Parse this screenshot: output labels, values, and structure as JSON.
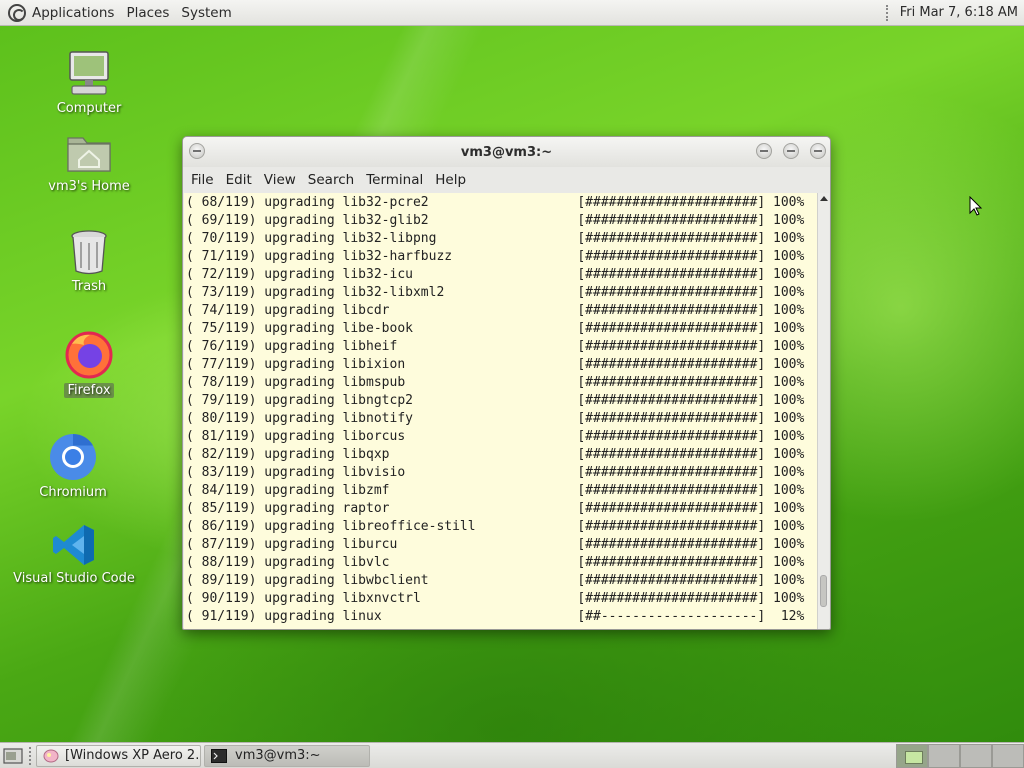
{
  "top_panel": {
    "menus": [
      "Applications",
      "Places",
      "System"
    ],
    "clock": "Fri Mar 7, 6:18 AM"
  },
  "desktop": {
    "icons": [
      {
        "label": "Computer",
        "icon": "computer-icon"
      },
      {
        "label": "vm3's Home",
        "icon": "home-folder-icon"
      },
      {
        "label": "Trash",
        "icon": "trash-icon"
      },
      {
        "label": "Firefox",
        "icon": "firefox-icon"
      },
      {
        "label": "Chromium",
        "icon": "chromium-icon"
      },
      {
        "label": "Visual Studio Code",
        "icon": "vscode-icon"
      }
    ]
  },
  "terminal": {
    "title": "vm3@vm3:~",
    "menu": [
      "File",
      "Edit",
      "View",
      "Search",
      "Terminal",
      "Help"
    ],
    "lines": [
      "( 68/119) upgrading lib32-pcre2                   [######################] 100%",
      "( 69/119) upgrading lib32-glib2                   [######################] 100%",
      "( 70/119) upgrading lib32-libpng                  [######################] 100%",
      "( 71/119) upgrading lib32-harfbuzz                [######################] 100%",
      "( 72/119) upgrading lib32-icu                     [######################] 100%",
      "( 73/119) upgrading lib32-libxml2                 [######################] 100%",
      "( 74/119) upgrading libcdr                        [######################] 100%",
      "( 75/119) upgrading libe-book                     [######################] 100%",
      "( 76/119) upgrading libheif                       [######################] 100%",
      "( 77/119) upgrading libixion                      [######################] 100%",
      "( 78/119) upgrading libmspub                      [######################] 100%",
      "( 79/119) upgrading libngtcp2                     [######################] 100%",
      "( 80/119) upgrading libnotify                     [######################] 100%",
      "( 81/119) upgrading liborcus                      [######################] 100%",
      "( 82/119) upgrading libqxp                        [######################] 100%",
      "( 83/119) upgrading libvisio                      [######################] 100%",
      "( 84/119) upgrading libzmf                        [######################] 100%",
      "( 85/119) upgrading raptor                        [######################] 100%",
      "( 86/119) upgrading libreoffice-still             [######################] 100%",
      "( 87/119) upgrading liburcu                       [######################] 100%",
      "( 88/119) upgrading libvlc                        [######################] 100%",
      "( 89/119) upgrading libwbclient                   [######################] 100%",
      "( 90/119) upgrading libxnvctrl                    [######################] 100%",
      "( 91/119) upgrading linux                         [##--------------------]  12%"
    ]
  },
  "taskbar": {
    "buttons": [
      {
        "label": "[Windows XP Aero 2...",
        "icon": "image-viewer-icon"
      },
      {
        "label": "vm3@vm3:~",
        "icon": "terminal-icon"
      }
    ]
  }
}
